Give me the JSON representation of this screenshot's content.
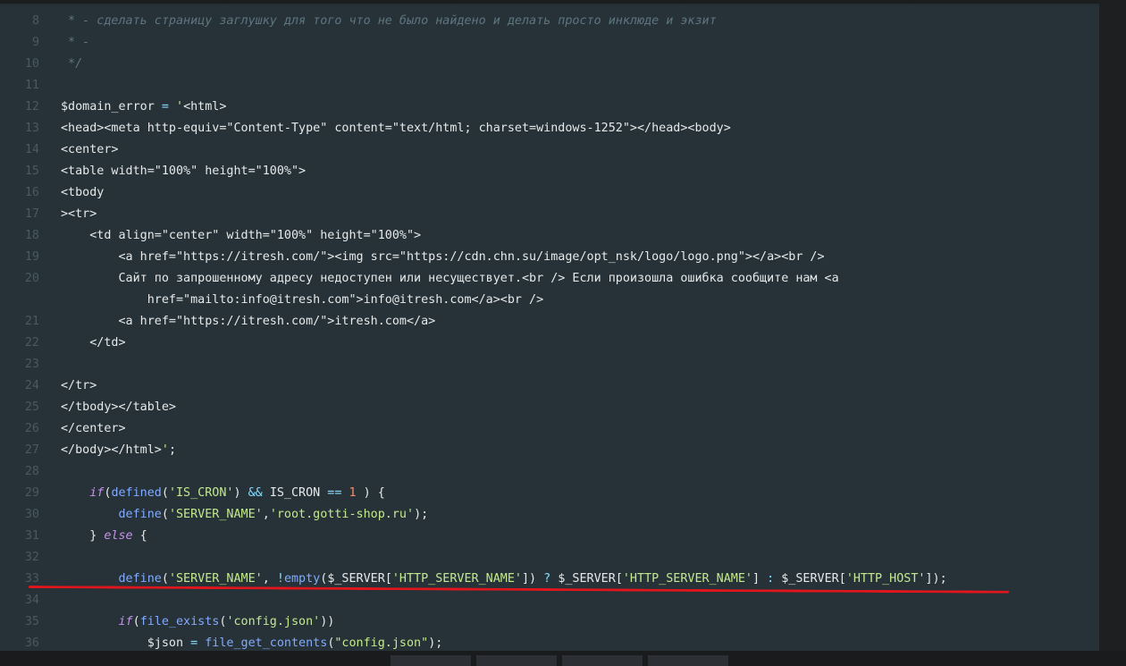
{
  "editor": {
    "lines": [
      {
        "num": "8",
        "indent": "",
        "tokens": [
          {
            "t": "cm",
            "v": " * - сделать страницу заглушку для того что не было найдено и делать просто инклюде и экзит"
          }
        ]
      },
      {
        "num": "9",
        "indent": "",
        "tokens": [
          {
            "t": "cm",
            "v": " * -"
          }
        ]
      },
      {
        "num": "10",
        "indent": "",
        "tokens": [
          {
            "t": "cm",
            "v": " */"
          }
        ]
      },
      {
        "num": "11",
        "indent": "",
        "tokens": []
      },
      {
        "num": "12",
        "indent": "",
        "tokens": [
          {
            "t": "var",
            "v": "$domain_error"
          },
          {
            "t": "op",
            "v": " = "
          },
          {
            "t": "str",
            "v": "'"
          },
          {
            "t": "tag",
            "v": "<html>"
          }
        ]
      },
      {
        "num": "13",
        "indent": "",
        "tokens": [
          {
            "t": "tag",
            "v": "<head><meta http-equiv=\"Content-Type\" content=\"text/html; charset=windows-1252\"></head><body>"
          }
        ]
      },
      {
        "num": "14",
        "indent": "",
        "tokens": [
          {
            "t": "tag",
            "v": "<center>"
          }
        ]
      },
      {
        "num": "15",
        "indent": "",
        "tokens": [
          {
            "t": "tag",
            "v": "<table width=\"100%\" height=\"100%\">"
          }
        ]
      },
      {
        "num": "16",
        "indent": "",
        "tokens": [
          {
            "t": "tag",
            "v": "<tbody"
          }
        ]
      },
      {
        "num": "17",
        "indent": "",
        "tokens": [
          {
            "t": "tag",
            "v": "><tr>"
          }
        ]
      },
      {
        "num": "18",
        "indent": "    ",
        "tokens": [
          {
            "t": "tag",
            "v": "<td align=\"center\" width=\"100%\" height=\"100%\">"
          }
        ]
      },
      {
        "num": "19",
        "indent": "        ",
        "tokens": [
          {
            "t": "tag",
            "v": "<a href=\"https://itresh.com/\"><img src=\"https://cdn.chn.su/image/opt_nsk/logo/logo.png\"></a><br />"
          }
        ]
      },
      {
        "num": "20",
        "indent": "        ",
        "tokens": [
          {
            "t": "tag",
            "v": "Сайт по запрошенному адресу недоступен или несуществует.<br /> Если произошла ошибка сообщите нам <a"
          }
        ]
      },
      {
        "num": "",
        "indent": "            ",
        "tokens": [
          {
            "t": "tag",
            "v": "href=\"mailto:info@itresh.com\">info@itresh.com</a><br />"
          }
        ]
      },
      {
        "num": "21",
        "indent": "        ",
        "tokens": [
          {
            "t": "tag",
            "v": "<a href=\"https://itresh.com/\">itresh.com</a>"
          }
        ]
      },
      {
        "num": "22",
        "indent": "    ",
        "tokens": [
          {
            "t": "tag",
            "v": "</td>"
          }
        ]
      },
      {
        "num": "23",
        "indent": "",
        "tokens": []
      },
      {
        "num": "24",
        "indent": "",
        "tokens": [
          {
            "t": "tag",
            "v": "</tr>"
          }
        ]
      },
      {
        "num": "25",
        "indent": "",
        "tokens": [
          {
            "t": "tag",
            "v": "</tbody></table>"
          }
        ]
      },
      {
        "num": "26",
        "indent": "",
        "tokens": [
          {
            "t": "tag",
            "v": "</center>"
          }
        ]
      },
      {
        "num": "27",
        "indent": "",
        "tokens": [
          {
            "t": "tag",
            "v": "</body></html>"
          },
          {
            "t": "str",
            "v": "'"
          },
          {
            "t": "pl",
            "v": ";"
          }
        ]
      },
      {
        "num": "28",
        "indent": "",
        "tokens": []
      },
      {
        "num": "29",
        "indent": "    ",
        "tokens": [
          {
            "t": "kw",
            "v": "if"
          },
          {
            "t": "br",
            "v": "("
          },
          {
            "t": "fn",
            "v": "defined"
          },
          {
            "t": "br",
            "v": "("
          },
          {
            "t": "str",
            "v": "'IS_CRON'"
          },
          {
            "t": "br",
            "v": ")"
          },
          {
            "t": "op",
            "v": " && "
          },
          {
            "t": "pl",
            "v": "IS_CRON"
          },
          {
            "t": "op",
            "v": " == "
          },
          {
            "t": "num",
            "v": "1"
          },
          {
            "t": "br",
            "v": " ) {"
          }
        ]
      },
      {
        "num": "30",
        "indent": "        ",
        "tokens": [
          {
            "t": "fn",
            "v": "define"
          },
          {
            "t": "br",
            "v": "("
          },
          {
            "t": "str",
            "v": "'SERVER_NAME'"
          },
          {
            "t": "pl",
            "v": ","
          },
          {
            "t": "str",
            "v": "'root.gotti-shop.ru'"
          },
          {
            "t": "br",
            "v": ");"
          }
        ]
      },
      {
        "num": "31",
        "indent": "    ",
        "tokens": [
          {
            "t": "br",
            "v": "} "
          },
          {
            "t": "kw",
            "v": "else"
          },
          {
            "t": "br",
            "v": " {"
          }
        ]
      },
      {
        "num": "32",
        "indent": "",
        "tokens": []
      },
      {
        "num": "33",
        "indent": "        ",
        "tokens": [
          {
            "t": "fn",
            "v": "define"
          },
          {
            "t": "br",
            "v": "("
          },
          {
            "t": "str",
            "v": "'SERVER_NAME'"
          },
          {
            "t": "pl",
            "v": ", "
          },
          {
            "t": "op",
            "v": "!"
          },
          {
            "t": "fn",
            "v": "empty"
          },
          {
            "t": "br",
            "v": "("
          },
          {
            "t": "var",
            "v": "$_SERVER"
          },
          {
            "t": "br",
            "v": "["
          },
          {
            "t": "str",
            "v": "'HTTP_SERVER_NAME'"
          },
          {
            "t": "br",
            "v": "])"
          },
          {
            "t": "op",
            "v": " ? "
          },
          {
            "t": "var",
            "v": "$_SERVER"
          },
          {
            "t": "br",
            "v": "["
          },
          {
            "t": "str",
            "v": "'HTTP_SERVER_NAME'"
          },
          {
            "t": "br",
            "v": "]"
          },
          {
            "t": "op",
            "v": " : "
          },
          {
            "t": "var",
            "v": "$_SERVER"
          },
          {
            "t": "br",
            "v": "["
          },
          {
            "t": "str",
            "v": "'HTTP_HOST'"
          },
          {
            "t": "br",
            "v": "]);"
          }
        ]
      },
      {
        "num": "34",
        "indent": "",
        "tokens": []
      },
      {
        "num": "35",
        "indent": "        ",
        "tokens": [
          {
            "t": "kw",
            "v": "if"
          },
          {
            "t": "br",
            "v": "("
          },
          {
            "t": "fn",
            "v": "file_exists"
          },
          {
            "t": "br",
            "v": "("
          },
          {
            "t": "str",
            "v": "'config.json'"
          },
          {
            "t": "br",
            "v": "))"
          }
        ]
      },
      {
        "num": "36",
        "indent": "            ",
        "tokens": [
          {
            "t": "var",
            "v": "$json"
          },
          {
            "t": "op",
            "v": " = "
          },
          {
            "t": "fn",
            "v": "file_get_contents"
          },
          {
            "t": "br",
            "v": "("
          },
          {
            "t": "str",
            "v": "\"config.json\""
          },
          {
            "t": "br",
            "v": ");"
          }
        ]
      }
    ]
  },
  "colors": {
    "editor_bg": "#263238",
    "annotation_underline": "#e0161c"
  }
}
